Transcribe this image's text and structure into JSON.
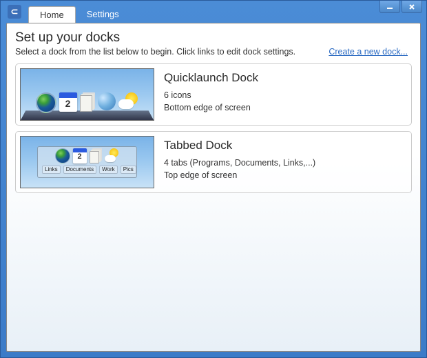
{
  "tabs": {
    "home": "Home",
    "settings": "Settings"
  },
  "header": {
    "title": "Set up your docks",
    "instruction": "Select a dock from the list below to begin. Click links to edit dock settings.",
    "create_link": "Create a new dock..."
  },
  "docks": [
    {
      "title": "Quicklaunch Dock",
      "count_line": "6 icons",
      "position_line": "Bottom edge of screen",
      "tab_labels": []
    },
    {
      "title": "Tabbed Dock",
      "count_line": "4 tabs (Programs, Documents, Links,...)",
      "position_line": "Top edge of screen",
      "tab_labels": [
        "Links",
        "Documents",
        "Work",
        "Pics"
      ]
    }
  ]
}
